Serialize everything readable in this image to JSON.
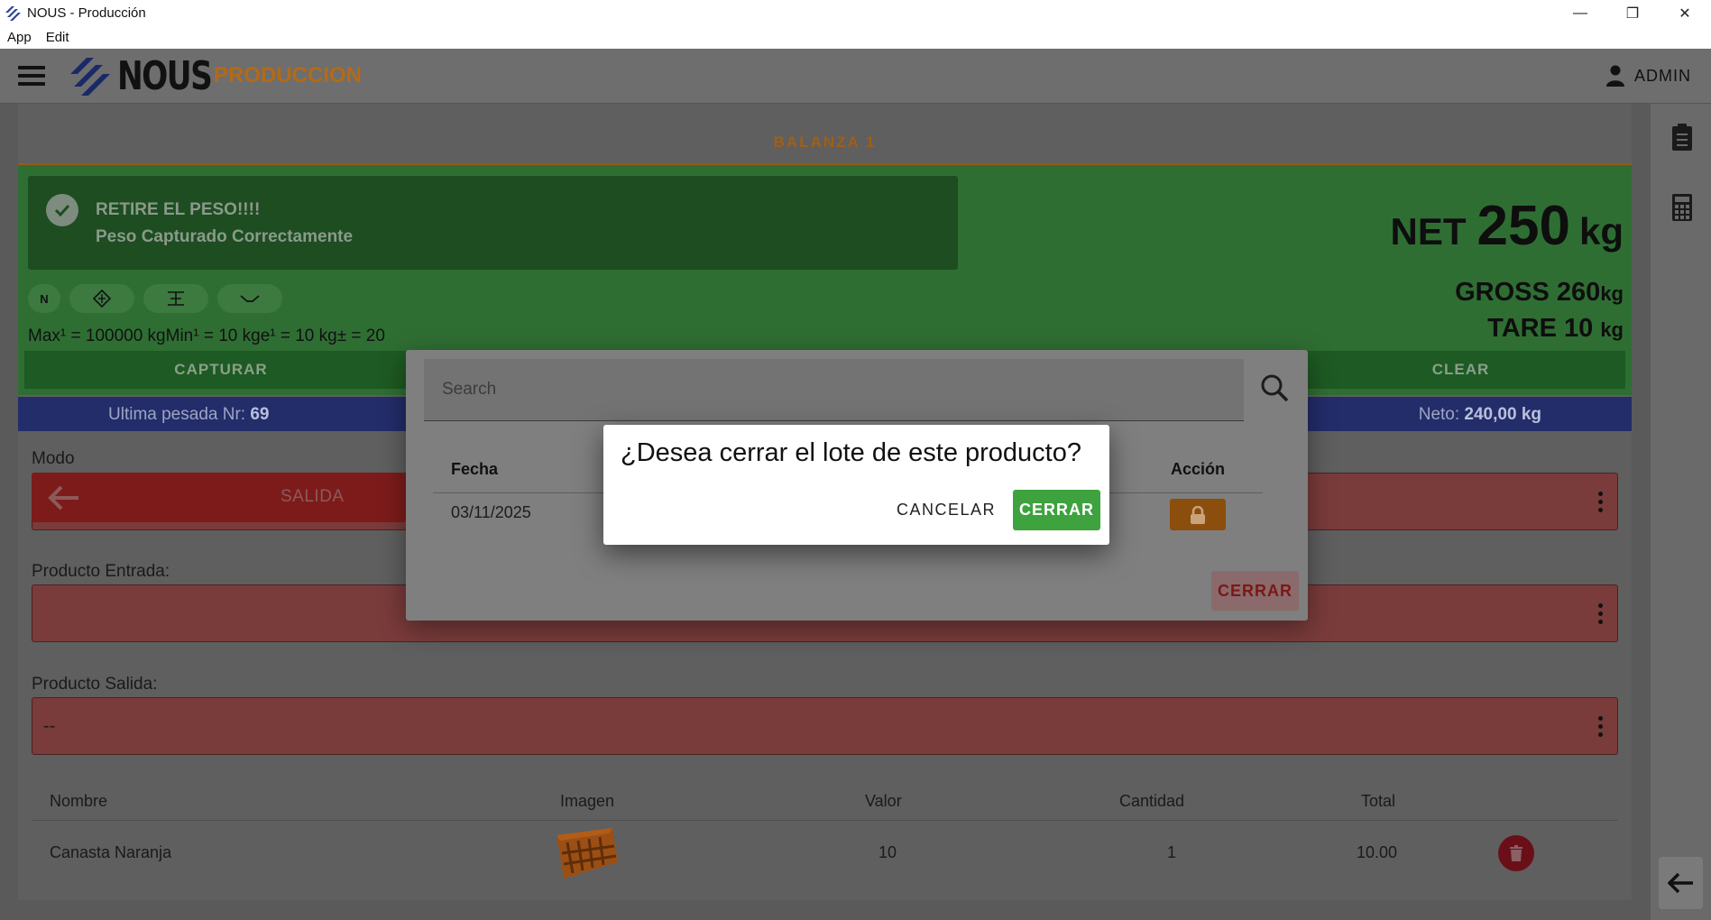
{
  "window": {
    "title": "NOUS - Producción",
    "min_symbol": "—",
    "max_symbol": "❐",
    "close_symbol": "✕"
  },
  "menu": [
    "App",
    "Edit"
  ],
  "header": {
    "logo": "NOUS",
    "module": "PRODUCCION",
    "user": "ADMIN"
  },
  "scale": {
    "name": "BALANZA 1",
    "alert_title": "RETIRE EL PESO!!!!",
    "alert_subtitle": "Peso Capturado Correctamente",
    "chip_n": "N",
    "capacity": "Max¹ = 100000 kgMin¹ = 10 kge¹ = 10 kg± = 20",
    "net_label": "NET",
    "net_value": "250",
    "net_unit": "kg",
    "gross_label": "GROSS 260",
    "gross_unit": "kg",
    "tare_label": "TARE 10",
    "tare_unit": "kg",
    "capture_label": "CAPTURAR",
    "clear_label": "CLEAR"
  },
  "info": {
    "last_label": "Ultima pesada Nr: ",
    "last_value": "69",
    "neto_label": "Neto: ",
    "neto_value": "240,00 kg"
  },
  "form": {
    "modo_label": "Modo",
    "modo_value": "SALIDA",
    "entrada_label": "Producto Entrada:",
    "salida_label": "Producto Salida:",
    "salida_value": "--"
  },
  "table": {
    "headers": [
      "Nombre",
      "Imagen",
      "Valor",
      "Cantidad",
      "Total"
    ],
    "rows": [
      {
        "nombre": "Canasta Naranja",
        "valor": "10",
        "cantidad": "1",
        "total": "10.00"
      }
    ]
  },
  "search_dialog": {
    "placeholder": "Search",
    "col_fecha": "Fecha",
    "col_accion": "Acción",
    "row_fecha": "03/11/2025",
    "close_label": "CERRAR"
  },
  "confirm_dialog": {
    "question": "¿Desea cerrar el lote de este producto?",
    "cancel_label": "CANCELAR",
    "ok_label": "CERRAR"
  },
  "colors": {
    "accent": "#d58a2c",
    "success": "#3ea23f",
    "danger": "#c83232"
  }
}
